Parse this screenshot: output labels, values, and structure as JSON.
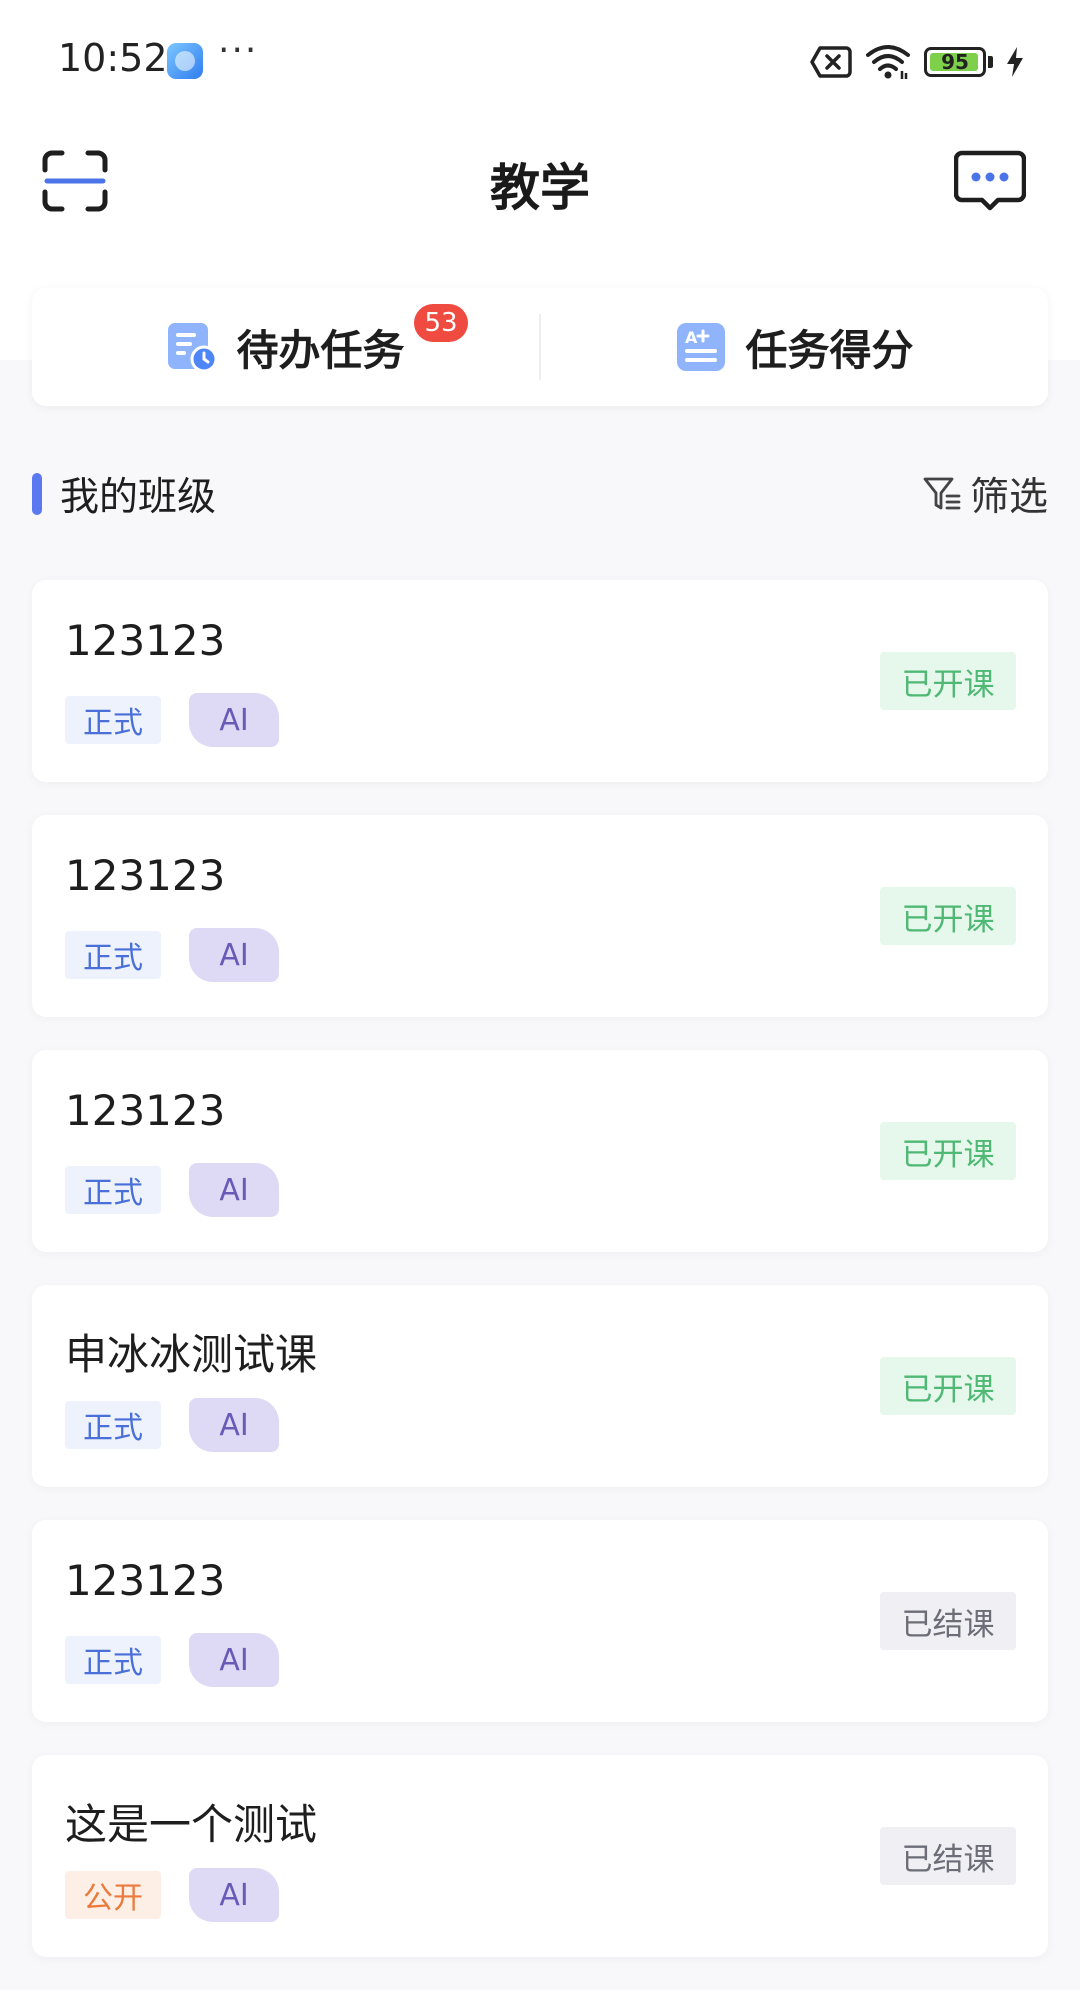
{
  "status_bar": {
    "time": "10:52",
    "more": "···",
    "battery_level": "95",
    "battery_fraction": 0.95,
    "icons": [
      "app-icon",
      "no-sim-icon",
      "wifi-icon",
      "battery-icon",
      "charging-icon"
    ]
  },
  "header": {
    "title": "教学",
    "left_icon": "scan-icon",
    "right_icon": "message-icon"
  },
  "quick_tabs": [
    {
      "label": "待办任务",
      "badge": "53",
      "icon": "todo-task-icon"
    },
    {
      "label": "任务得分",
      "icon": "score-icon"
    }
  ],
  "section": {
    "title": "我的班级",
    "filter_label": "筛选",
    "accent_color": "#5a78f0"
  },
  "classes": [
    {
      "name": "123123",
      "type": "正式",
      "ai": "AI",
      "status": "已开课"
    },
    {
      "name": "123123",
      "type": "正式",
      "ai": "AI",
      "status": "已开课"
    },
    {
      "name": "123123",
      "type": "正式",
      "ai": "AI",
      "status": "已开课"
    },
    {
      "name": "申冰冰测试课",
      "type": "正式",
      "ai": "AI",
      "status": "已开课"
    },
    {
      "name": "123123",
      "type": "正式",
      "ai": "AI",
      "status": "已结课"
    },
    {
      "name": "这是一个测试",
      "type": "公开",
      "ai": "AI",
      "status": "已结课"
    }
  ]
}
